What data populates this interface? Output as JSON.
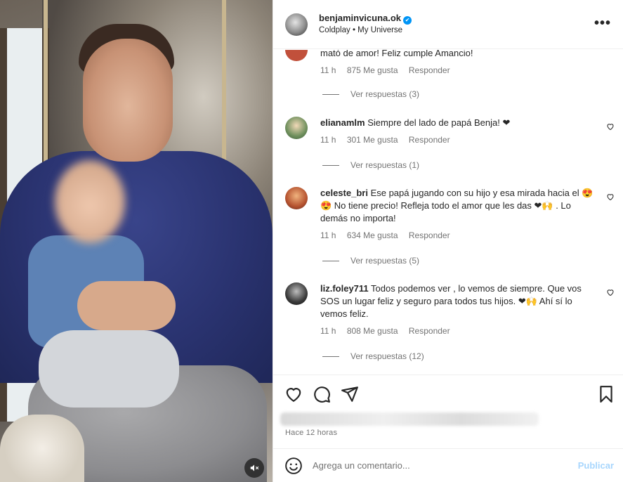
{
  "post": {
    "username": "benjaminvicuna.ok",
    "subtitle": "Coldplay • My Universe",
    "more_label": "•••"
  },
  "comments": [
    {
      "text": "mató de amor! Feliz cumple Amancio!",
      "time": "11 h",
      "likes": "875 Me gusta",
      "reply": "Responder",
      "view_replies": "Ver respuestas (3)"
    },
    {
      "username": "elianamlm",
      "text": "Siempre del lado de papá Benja! ❤",
      "time": "11 h",
      "likes": "301 Me gusta",
      "reply": "Responder",
      "view_replies": "Ver respuestas (1)"
    },
    {
      "username": "celeste_bri",
      "text": "Ese papá jugando con su hijo y esa mirada hacia el 😍😍 No tiene precio! Refleja todo el amor que les das ❤🙌 . Lo demás no importa!",
      "time": "11 h",
      "likes": "634 Me gusta",
      "reply": "Responder",
      "view_replies": "Ver respuestas (5)"
    },
    {
      "username": "liz.foley711",
      "text": "Todos podemos ver , lo vemos de siempre. Que vos SOS un lugar feliz y seguro para todos tus hijos. ❤🙌 Ahí sí lo vemos feliz.",
      "time": "11 h",
      "likes": "808 Me gusta",
      "reply": "Responder",
      "view_replies": "Ver respuestas (12)"
    }
  ],
  "footer": {
    "time_ago": "Hace 12 horas",
    "comment_placeholder": "Agrega un comentario...",
    "publish_label": "Publicar"
  }
}
